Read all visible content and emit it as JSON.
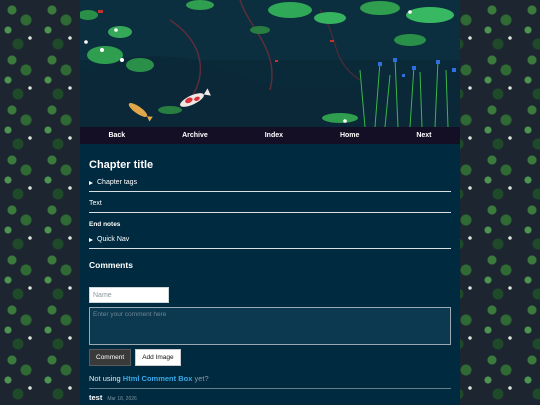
{
  "nav": {
    "items": [
      "Back",
      "Archive",
      "Index",
      "Home",
      "Next"
    ]
  },
  "chapter": {
    "title": "Chapter title",
    "tags_label": "Chapter tags",
    "text": "Text",
    "end_notes_label": "End notes",
    "quick_nav_label": "Quick Nav"
  },
  "comments": {
    "heading": "Comments",
    "name_placeholder": "Name",
    "comment_placeholder": "Enter your comment here",
    "comment_button": "Comment",
    "add_image_button": "Add Image",
    "not_using_prefix": "Not using",
    "not_using_link": "Html Comment Box",
    "not_using_suffix": "yet?",
    "entries": [
      {
        "author": "test",
        "date": "Mar 18, 2026"
      }
    ]
  },
  "colors": {
    "page_bg": "#002a3f",
    "nav_bg": "#150f26",
    "link_blue": "#3aa8e8"
  },
  "icons": {
    "disclosure": "triangle-right-icon"
  }
}
